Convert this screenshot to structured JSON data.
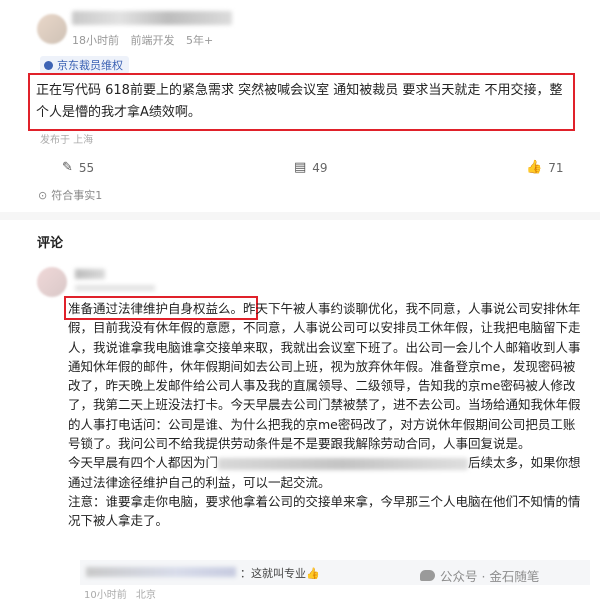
{
  "post": {
    "time": "18小时前",
    "role": "前端开发",
    "years": "5年+",
    "tag": "京东裁员维权",
    "body": "正在写代码 618前要上的紧急需求 突然被喊会议室 通知被裁员 要求当天就走 不用交接，整个人是懵的我才拿A绩效啊。",
    "posted_from": "发布于 上海",
    "stats": {
      "edit": "55",
      "comments": "49",
      "likes": "71"
    },
    "thanks": "符合事实1"
  },
  "comments_title": "评论",
  "comment": {
    "lines": [
      "准备通过法律维护自身权益么。昨天下午被人事约谈聊优化，我不同意，人事说公司安排休年假，目前我没有休年假的意愿，不同意，人事说公司可以安排员工休年假，让我把电脑留下走人，我说谁拿我电脑谁拿交接单来取，我就出会议室下班了。出公司一会儿个人邮箱收到人事通知休年假的邮件，休年假期间如去公司上班，视为放弃休年假。准备登京me，发现密码被改了，昨天晚上发邮件给公司人事及我的直属领导、二级领导，告知我的京me密码被人修改了，我第二天上班没法打卡。今天早晨去公司门禁被禁了，进不去公司。当场给通知我休年假的人事打电话问：公司是谁、为什么把我的京me密码改了，对方说休年假期间公司把员工账号锁了。我问公司不给我提供劳动条件是不是要跟我解除劳动合同，人事回复说是。"
    ],
    "line2_a": "今天早晨有四个人都因为门",
    "line2_b": "后续太多，如果你想通过法律途径维护自己的利益，可以一起交流。",
    "line3": "注意：谁要拿走你电脑，要求他拿着公司的交接单来拿，今早那三个人电脑在他们不知情的情况下被人拿走了。"
  },
  "reply": {
    "text": "：这就叫专业👍",
    "time": "10小时前",
    "location": "北京"
  },
  "watermark": "公众号 · 金石随笔"
}
